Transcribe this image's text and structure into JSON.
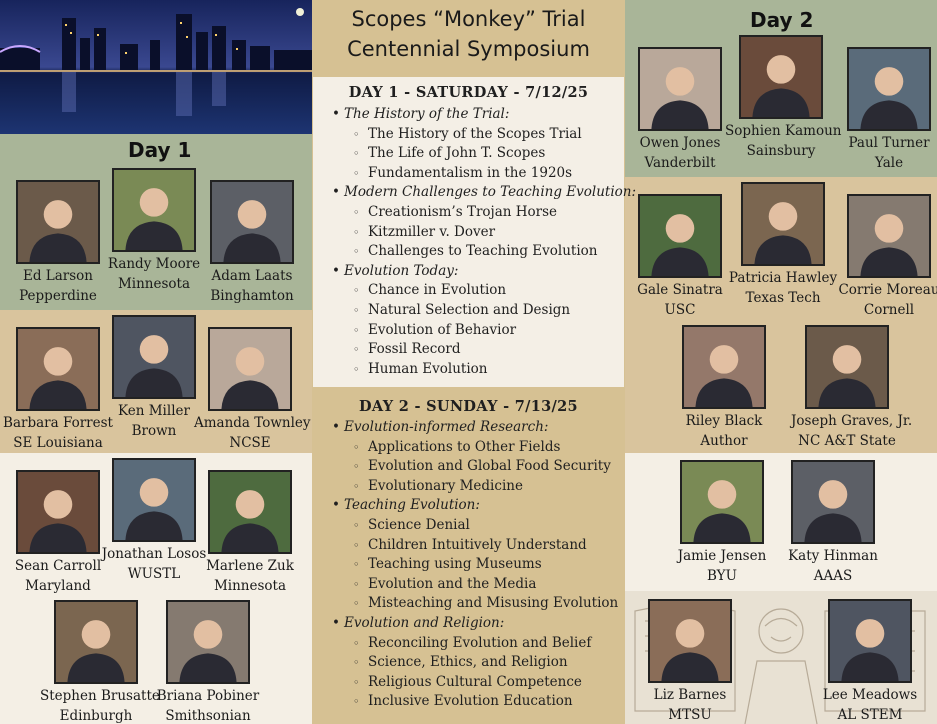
{
  "title": {
    "line1": "Scopes “Monkey” Trial",
    "line2": "Centennial Symposium"
  },
  "day1_heading": "Day 1",
  "day2_heading": "Day 2",
  "day1_speakers": [
    {
      "name": "Ed Larson",
      "institution": "Pepperdine"
    },
    {
      "name": "Randy Moore",
      "institution": "Minnesota"
    },
    {
      "name": "Adam Laats",
      "institution": "Binghamton"
    },
    {
      "name": "Barbara Forrest",
      "institution": "SE Louisiana"
    },
    {
      "name": "Ken Miller",
      "institution": "Brown"
    },
    {
      "name": "Amanda Townley",
      "institution": "NCSE"
    },
    {
      "name": "Sean Carroll",
      "institution": "Maryland"
    },
    {
      "name": "Jonathan Losos",
      "institution": "WUSTL"
    },
    {
      "name": "Marlene Zuk",
      "institution": "Minnesota"
    },
    {
      "name": "Stephen Brusatte",
      "institution": "Edinburgh"
    },
    {
      "name": "Briana Pobiner",
      "institution": "Smithsonian"
    }
  ],
  "day2_speakers": [
    {
      "name": "Owen Jones",
      "institution": "Vanderbilt"
    },
    {
      "name": "Sophien Kamoun",
      "institution": "Sainsbury"
    },
    {
      "name": "Paul Turner",
      "institution": "Yale"
    },
    {
      "name": "Gale Sinatra",
      "institution": "USC"
    },
    {
      "name": "Patricia Hawley",
      "institution": "Texas Tech"
    },
    {
      "name": "Corrie Moreau",
      "institution": "Cornell"
    },
    {
      "name": "Riley Black",
      "institution": "Author"
    },
    {
      "name": "Joseph Graves, Jr.",
      "institution": "NC A&T State"
    },
    {
      "name": "Jamie Jensen",
      "institution": "BYU"
    },
    {
      "name": "Katy Hinman",
      "institution": "AAAS"
    },
    {
      "name": "Liz Barnes",
      "institution": "MTSU"
    },
    {
      "name": "Lee Meadows",
      "institution": "AL STEM"
    }
  ],
  "day1_schedule": {
    "heading": "DAY 1 - SATURDAY - 7/12/25",
    "sections": [
      {
        "title": "The History of the Trial:",
        "items": [
          "The History of the Scopes Trial",
          "The Life of John T. Scopes",
          "Fundamentalism in the 1920s"
        ]
      },
      {
        "title": "Modern Challenges to Teaching Evolution:",
        "items": [
          "Creationism’s Trojan Horse",
          "Kitzmiller v. Dover",
          "Challenges to Teaching Evolution"
        ]
      },
      {
        "title": "Evolution Today:",
        "items": [
          "Chance in Evolution",
          "Natural Selection and Design",
          "Evolution of Behavior",
          "Fossil Record",
          "Human Evolution"
        ]
      }
    ]
  },
  "day2_schedule": {
    "heading": "DAY 2 - SUNDAY - 7/13/25",
    "sections": [
      {
        "title": "Evolution-informed Research:",
        "items": [
          "Applications to Other Fields",
          "Evolution and Global Food Security",
          "Evolutionary Medicine"
        ]
      },
      {
        "title": "Teaching Evolution:",
        "items": [
          "Science Denial",
          "Children Intuitively Understand",
          "Teaching using Museums",
          "Evolution and the Media",
          "Misteaching and Misusing Evolution"
        ]
      },
      {
        "title": "Evolution and Religion:",
        "items": [
          "Reconciling Evolution and Belief",
          "Science, Ethics, and Religion",
          "Religious Cultural Competence",
          "Inclusive Evolution Education"
        ]
      }
    ]
  },
  "colors": {
    "green": "#a9b598",
    "tan": "#d9c49d",
    "cream": "#f4efe5",
    "center": "#d6c193"
  },
  "icons": {
    "skyline": "city-skyline-icon",
    "portrait": "person-portrait-icon",
    "monkey_art": "monkey-judge-illustration"
  }
}
